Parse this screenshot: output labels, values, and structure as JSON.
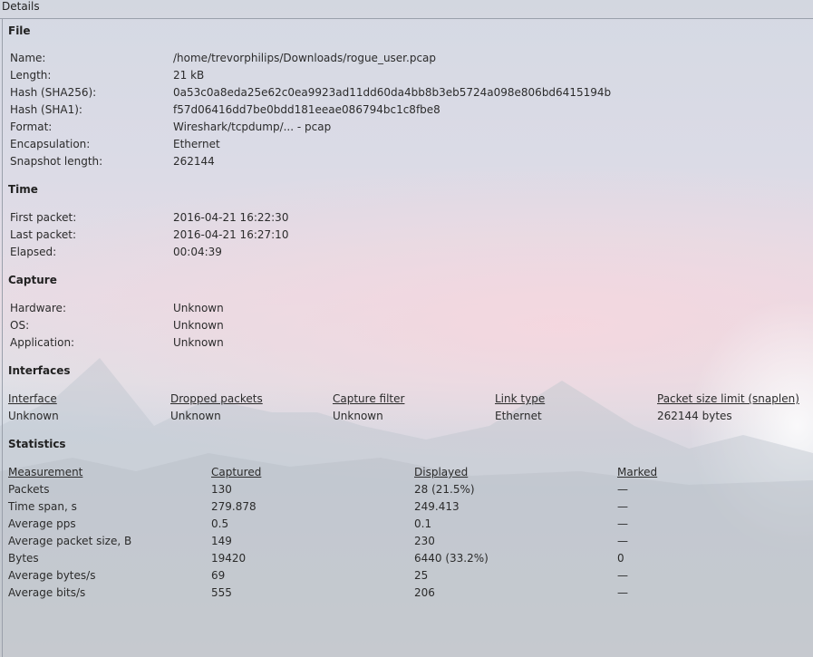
{
  "window": {
    "title": "Details"
  },
  "file": {
    "heading": "File",
    "rows": [
      {
        "label": "Name:",
        "value": "/home/trevorphilips/Downloads/rogue_user.pcap"
      },
      {
        "label": "Length:",
        "value": "21 kB"
      },
      {
        "label": "Hash (SHA256):",
        "value": "0a53c0a8eda25e62c0ea9923ad11dd60da4bb8b3eb5724a098e806bd6415194b"
      },
      {
        "label": "Hash (SHA1):",
        "value": "f57d06416dd7be0bdd181eeae086794bc1c8fbe8"
      },
      {
        "label": "Format:",
        "value": "Wireshark/tcpdump/... - pcap"
      },
      {
        "label": "Encapsulation:",
        "value": "Ethernet"
      },
      {
        "label": "Snapshot length:",
        "value": "262144"
      }
    ]
  },
  "time": {
    "heading": "Time",
    "rows": [
      {
        "label": "First packet:",
        "value": "2016-04-21 16:22:30"
      },
      {
        "label": "Last packet:",
        "value": "2016-04-21 16:27:10"
      },
      {
        "label": "Elapsed:",
        "value": "00:04:39"
      }
    ]
  },
  "capture": {
    "heading": "Capture",
    "rows": [
      {
        "label": "Hardware:",
        "value": "Unknown"
      },
      {
        "label": "OS:",
        "value": "Unknown"
      },
      {
        "label": "Application:",
        "value": "Unknown"
      }
    ]
  },
  "interfaces": {
    "heading": "Interfaces",
    "columns": [
      "Interface",
      "Dropped packets",
      "Capture filter",
      "Link type",
      "Packet size limit (snaplen)"
    ],
    "rows": [
      [
        "Unknown",
        "Unknown",
        "Unknown",
        "Ethernet",
        "262144 bytes"
      ]
    ]
  },
  "statistics": {
    "heading": "Statistics",
    "columns": [
      "Measurement",
      "Captured",
      "Displayed",
      "Marked"
    ],
    "rows": [
      [
        "Packets",
        "130",
        "28 (21.5%)",
        "—"
      ],
      [
        "Time span, s",
        "279.878",
        "249.413",
        "—"
      ],
      [
        "Average pps",
        "0.5",
        "0.1",
        "—"
      ],
      [
        "Average packet size, B",
        "149",
        "230",
        "—"
      ],
      [
        "Bytes",
        "19420",
        "6440 (33.2%)",
        "0"
      ],
      [
        "Average bytes/s",
        "69",
        "25",
        "—"
      ],
      [
        "Average bits/s",
        "555",
        "206",
        "—"
      ]
    ]
  }
}
